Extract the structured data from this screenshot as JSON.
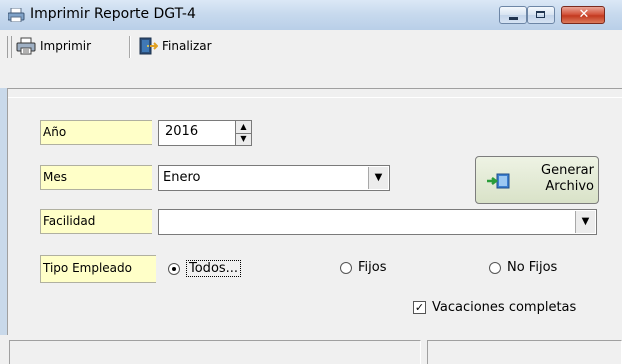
{
  "window": {
    "title": "Imprimir Reporte DGT-4",
    "close_glyph": "✕"
  },
  "toolbar": {
    "print_label": "Imprimir",
    "finish_label": "Finalizar"
  },
  "form": {
    "anio_label": "Año",
    "anio_value": "2016",
    "mes_label": "Mes",
    "mes_value": "Enero",
    "facilidad_label": "Facilidad",
    "facilidad_value": "",
    "tipo_label": "Tipo Empleado",
    "generate_line1": "Generar",
    "generate_line2": "Archivo",
    "radio_todos": "Todos...",
    "radio_fijos": "Fijos",
    "radio_nofijos": "No Fijos",
    "selected_radio": "Todos...",
    "vacaciones_label": "Vacaciones completas",
    "vacaciones_checked": true,
    "check_glyph": "✓"
  },
  "icons": {
    "app": "printer-doc-icon",
    "print": "printer-icon",
    "finish": "exit-door-icon",
    "generate": "arrow-file-icon"
  },
  "colors": {
    "label_bg": "#ffffc8",
    "titlebar": "#c8daee",
    "close_red": "#c33a20"
  }
}
